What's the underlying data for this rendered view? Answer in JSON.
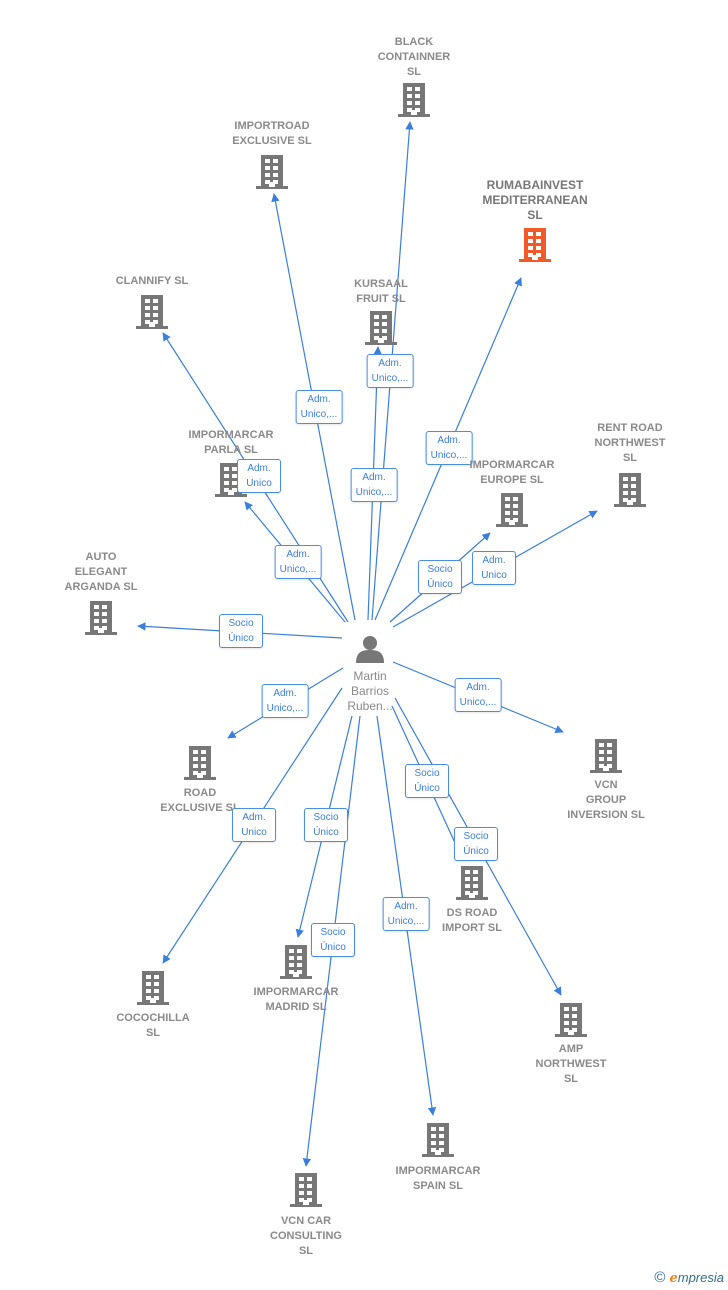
{
  "colors": {
    "edge": "#3a7fd9",
    "building": "#777777",
    "highlight": "#f05a28",
    "person": "#777777"
  },
  "center": {
    "name": "Martin\nBarrios\nRuben...",
    "icon": "person-icon"
  },
  "nodes": [
    {
      "id": "black-containner",
      "name": "BLACK\nCONTAINNER\nSL",
      "relation": "Adm.\nUnico,...",
      "icon": "building-icon"
    },
    {
      "id": "importroad-exclusive",
      "name": "IMPORTROAD\nEXCLUSIVE  SL",
      "relation": "Adm.\nUnico,...",
      "icon": "building-icon"
    },
    {
      "id": "rumabainvest-mediterranean",
      "name": "RUMABAINVEST\nMEDITERRANEAN\nSL",
      "relation": "Adm.\nUnico,...",
      "icon": "building-icon",
      "highlight": true
    },
    {
      "id": "clannify",
      "name": "CLANNIFY  SL",
      "relation": "Adm.\nUnico",
      "icon": "building-icon"
    },
    {
      "id": "kursaal-fruit",
      "name": "KURSAAL\nFRUIT  SL",
      "relation": "Adm.\nUnico,...",
      "icon": "building-icon"
    },
    {
      "id": "impormarcar-parla",
      "name": "IMPORMARCAR\nPARLA  SL",
      "relation": "Adm.\nUnico,...",
      "icon": "building-icon"
    },
    {
      "id": "impormarcar-europe",
      "name": "IMPORMARCAR\nEUROPE  SL",
      "relation": "Socio\nÚnico",
      "icon": "building-icon"
    },
    {
      "id": "rent-road-northwest",
      "name": "RENT ROAD\nNORTHWEST\nSL",
      "relation": "Adm.\nUnico",
      "icon": "building-icon"
    },
    {
      "id": "auto-elegant-arganda",
      "name": "AUTO\nELEGANT\nARGANDA  SL",
      "relation": "Socio\nÚnico",
      "icon": "building-icon"
    },
    {
      "id": "road-exclusive",
      "name": "ROAD\nEXCLUSIVE  SL",
      "relation": "Adm.\nUnico,...",
      "icon": "building-icon"
    },
    {
      "id": "vcn-group-inversion",
      "name": "VCN\nGROUP\nINVERSION  SL",
      "relation": "Adm.\nUnico,...",
      "icon": "building-icon"
    },
    {
      "id": "cocochilla",
      "name": "COCOCHILLA\nSL",
      "relation": "Adm.\nUnico",
      "icon": "building-icon"
    },
    {
      "id": "impormarcar-madrid",
      "name": "IMPORMARCAR\nMADRID  SL",
      "relation": "Socio\nÚnico",
      "icon": "building-icon"
    },
    {
      "id": "vcn-car-consulting",
      "name": "VCN CAR\nCONSULTING\nSL",
      "relation": "Socio\nÚnico",
      "icon": "building-icon"
    },
    {
      "id": "impormarcar-spain",
      "name": "IMPORMARCAR\nSPAIN  SL",
      "relation": "Adm.\nUnico,...",
      "icon": "building-icon"
    },
    {
      "id": "ds-road-import",
      "name": "DS ROAD\nIMPORT  SL",
      "relation": "Socio\nÚnico",
      "icon": "building-icon"
    },
    {
      "id": "amp-northwest",
      "name": "AMP\nNORTHWEST\nSL",
      "relation": "Socio\nÚnico",
      "icon": "building-icon"
    }
  ],
  "footer": {
    "copyright": "©",
    "brand_initial": "e",
    "brand_rest": "mpresia"
  }
}
